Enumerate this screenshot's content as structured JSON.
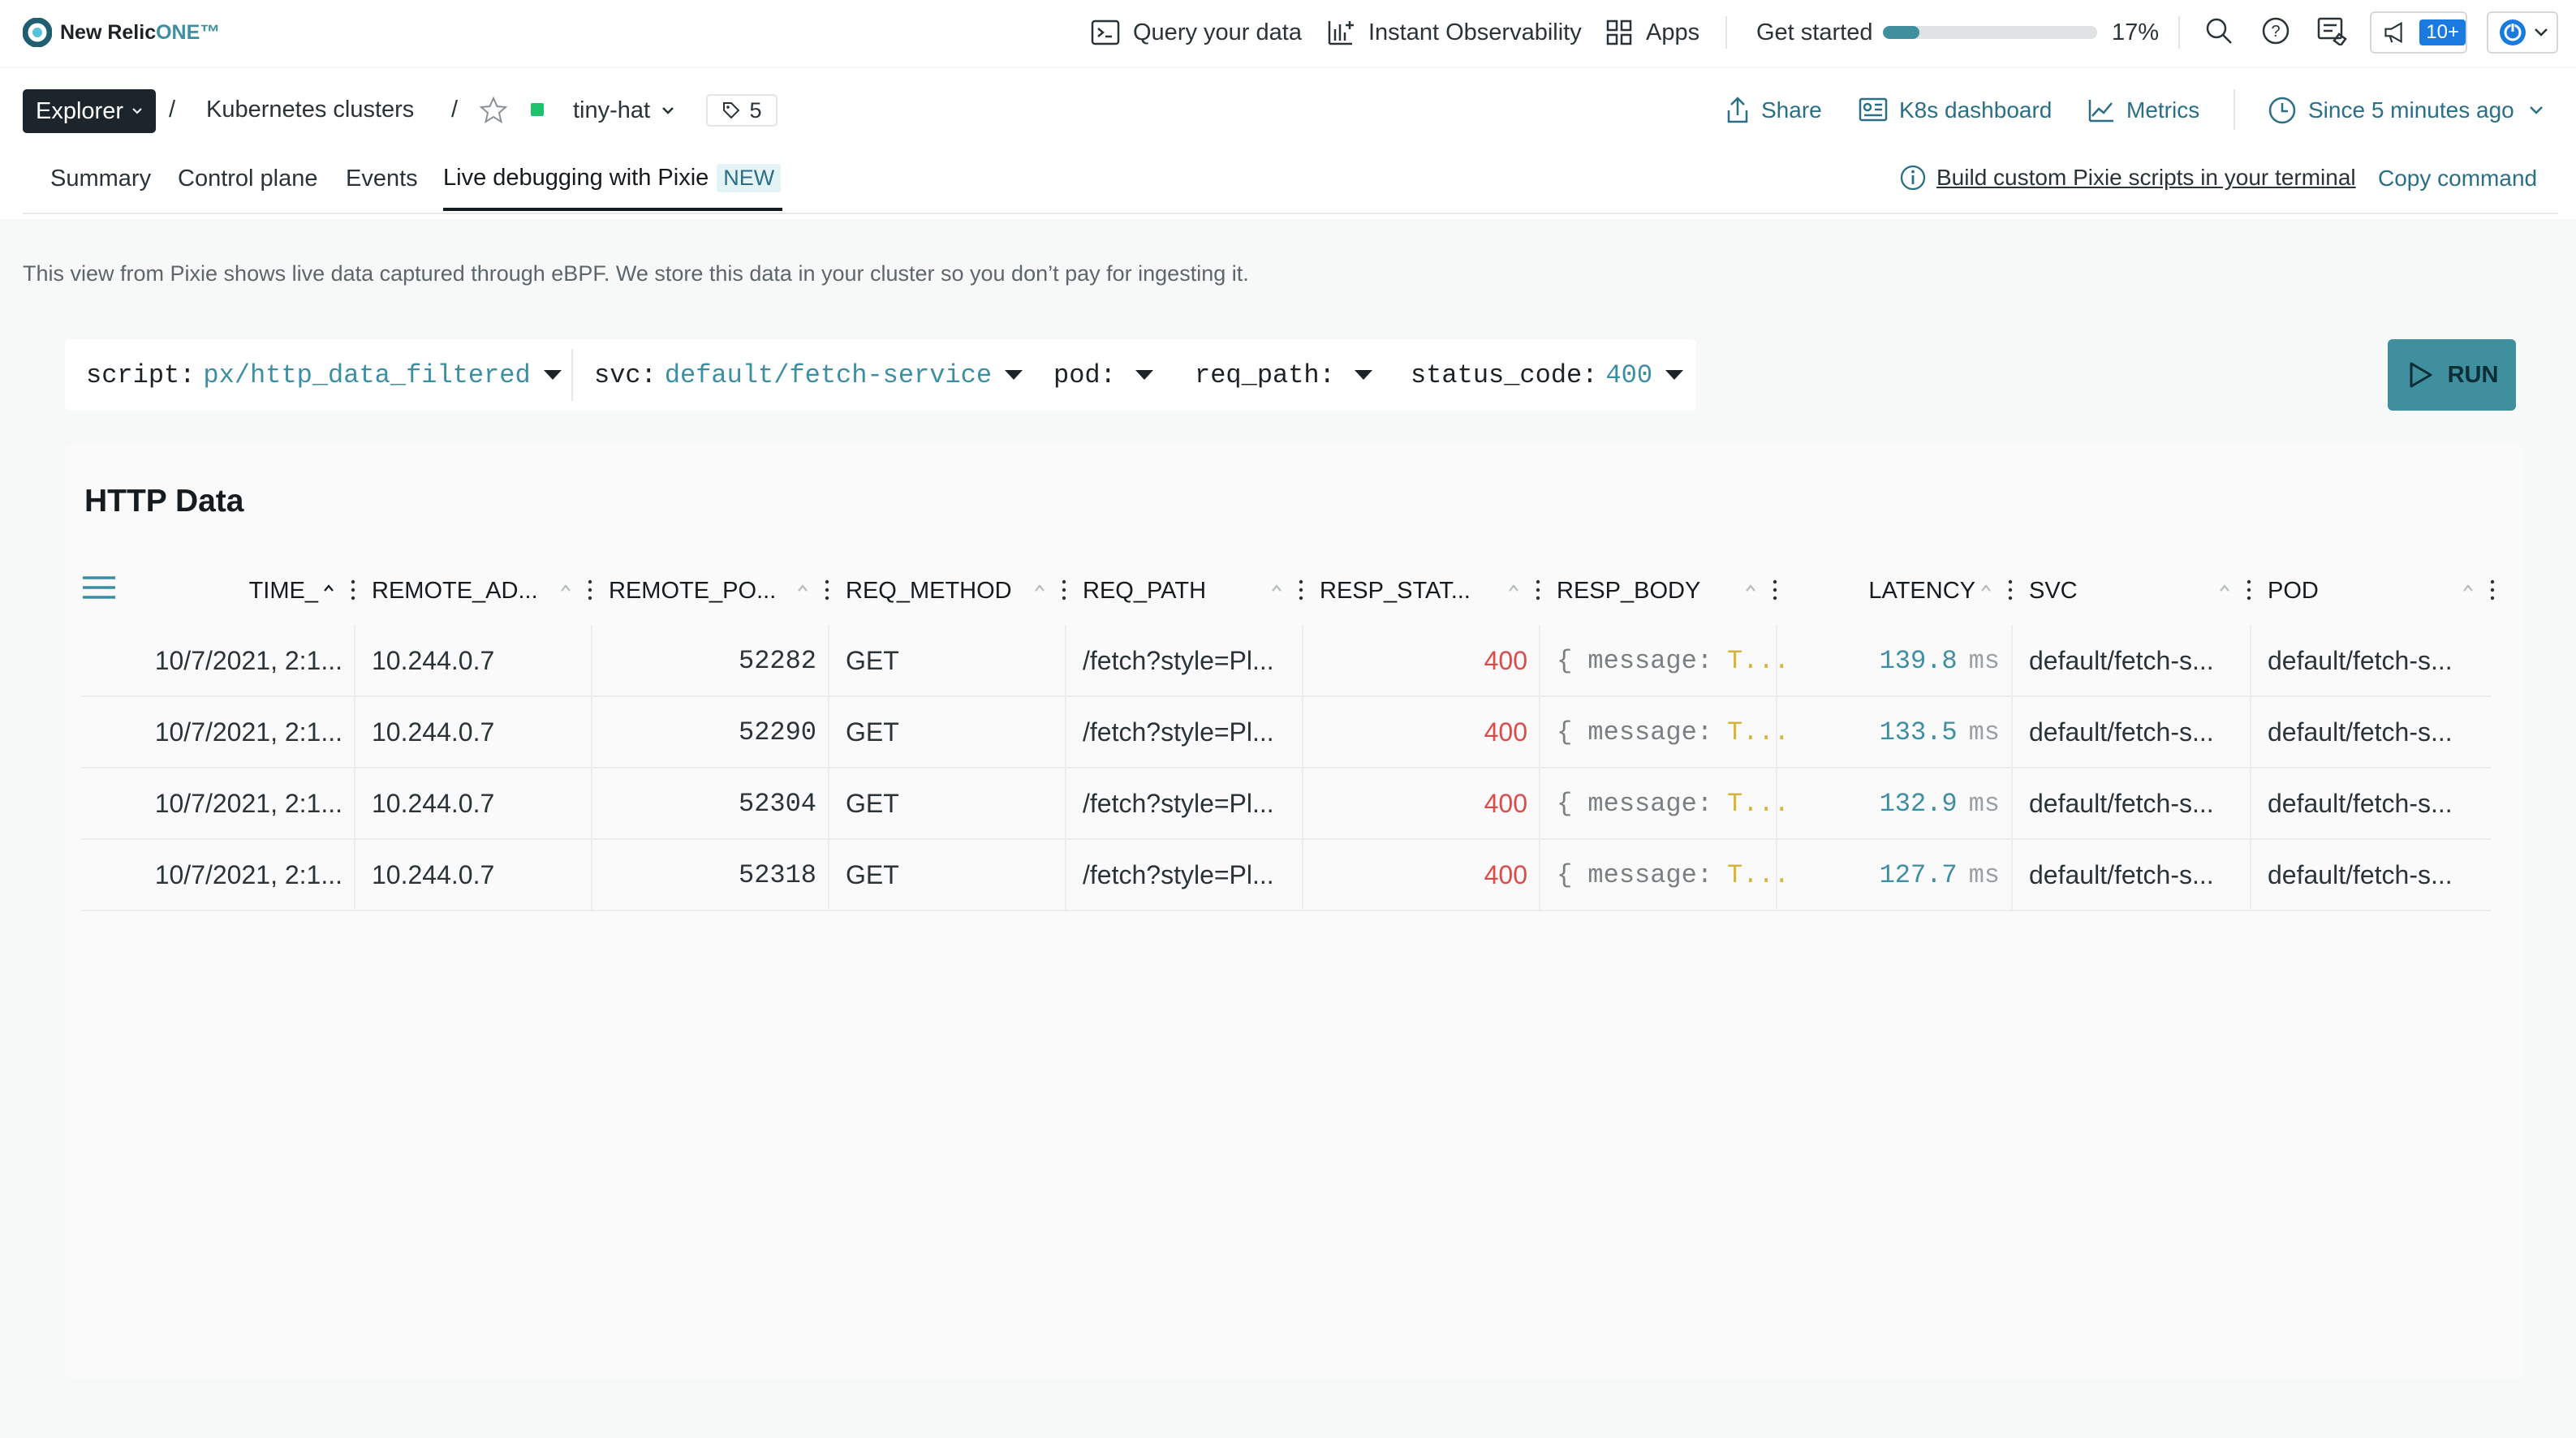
{
  "app": {
    "logo_text": "New Relic ",
    "logo_one": "ONE™"
  },
  "topnav": {
    "query_label": "Query your data",
    "instant_label": "Instant Observability",
    "apps_label": "Apps",
    "get_started_label": "Get started",
    "progress_percent": 17,
    "progress_text": "17%",
    "notifications_badge": "10+"
  },
  "breadcrumb": {
    "explorer_label": "Explorer",
    "sep1": "/",
    "clusters_label": "Kubernetes clusters",
    "sep2": "/",
    "entity_name": "tiny-hat",
    "tag_count": "5",
    "entity_status_color": "#1ec26a"
  },
  "actions": {
    "share_label": "Share",
    "k8s_label": "K8s dashboard",
    "metrics_label": "Metrics",
    "time_label": "Since 5 minutes ago"
  },
  "tabs": [
    {
      "label": "Summary"
    },
    {
      "label": "Control plane"
    },
    {
      "label": "Events"
    },
    {
      "label": "Live debugging with Pixie",
      "badge": "NEW"
    }
  ],
  "pixie_hint": {
    "build_label": "Build custom Pixie scripts in your terminal",
    "copy_label": "Copy command"
  },
  "description": "This view from Pixie shows live data captured through eBPF. We store this data in your cluster so you don’t pay for ingesting it.",
  "filters": {
    "script_key": "script:",
    "script_value": "px/http_data_filtered",
    "svc_key": "svc:",
    "svc_value": "default/fetch-service",
    "pod_key": "pod:",
    "req_path_key": "req_path:",
    "status_code_key": "status_code:",
    "status_code_value": "400"
  },
  "run_label": "RUN",
  "table": {
    "title": "HTTP Data",
    "columns": [
      "TIME_",
      "REMOTE_AD...",
      "REMOTE_PO...",
      "REQ_METHOD",
      "REQ_PATH",
      "RESP_STAT...",
      "RESP_BODY",
      "LATENCY",
      "SVC",
      "POD"
    ],
    "rows": [
      {
        "time": "10/7/2021, 2:1...",
        "remote_addr": "10.244.0.7",
        "remote_port": "52282",
        "method": "GET",
        "path": "/fetch?style=Pl...",
        "status": "400",
        "body_key": "{ message:",
        "body_val": "T...",
        "latency": "139.8",
        "latency_unit": "ms",
        "svc": "default/fetch-s...",
        "pod": "default/fetch-s..."
      },
      {
        "time": "10/7/2021, 2:1...",
        "remote_addr": "10.244.0.7",
        "remote_port": "52290",
        "method": "GET",
        "path": "/fetch?style=Pl...",
        "status": "400",
        "body_key": "{ message:",
        "body_val": "T...",
        "latency": "133.5",
        "latency_unit": "ms",
        "svc": "default/fetch-s...",
        "pod": "default/fetch-s..."
      },
      {
        "time": "10/7/2021, 2:1...",
        "remote_addr": "10.244.0.7",
        "remote_port": "52304",
        "method": "GET",
        "path": "/fetch?style=Pl...",
        "status": "400",
        "body_key": "{ message:",
        "body_val": "T...",
        "latency": "132.9",
        "latency_unit": "ms",
        "svc": "default/fetch-s...",
        "pod": "default/fetch-s..."
      },
      {
        "time": "10/7/2021, 2:1...",
        "remote_addr": "10.244.0.7",
        "remote_port": "52318",
        "method": "GET",
        "path": "/fetch?style=Pl...",
        "status": "400",
        "body_key": "{ message:",
        "body_val": "T...",
        "latency": "127.7",
        "latency_unit": "ms",
        "svc": "default/fetch-s...",
        "pod": "default/fetch-s..."
      }
    ]
  },
  "colors": {
    "accent": "#3f8f9e",
    "link": "#2a6f85",
    "status_error": "#d94c4c",
    "latency": "#3c8fa3",
    "badge_bg": "#e4f3f6"
  }
}
